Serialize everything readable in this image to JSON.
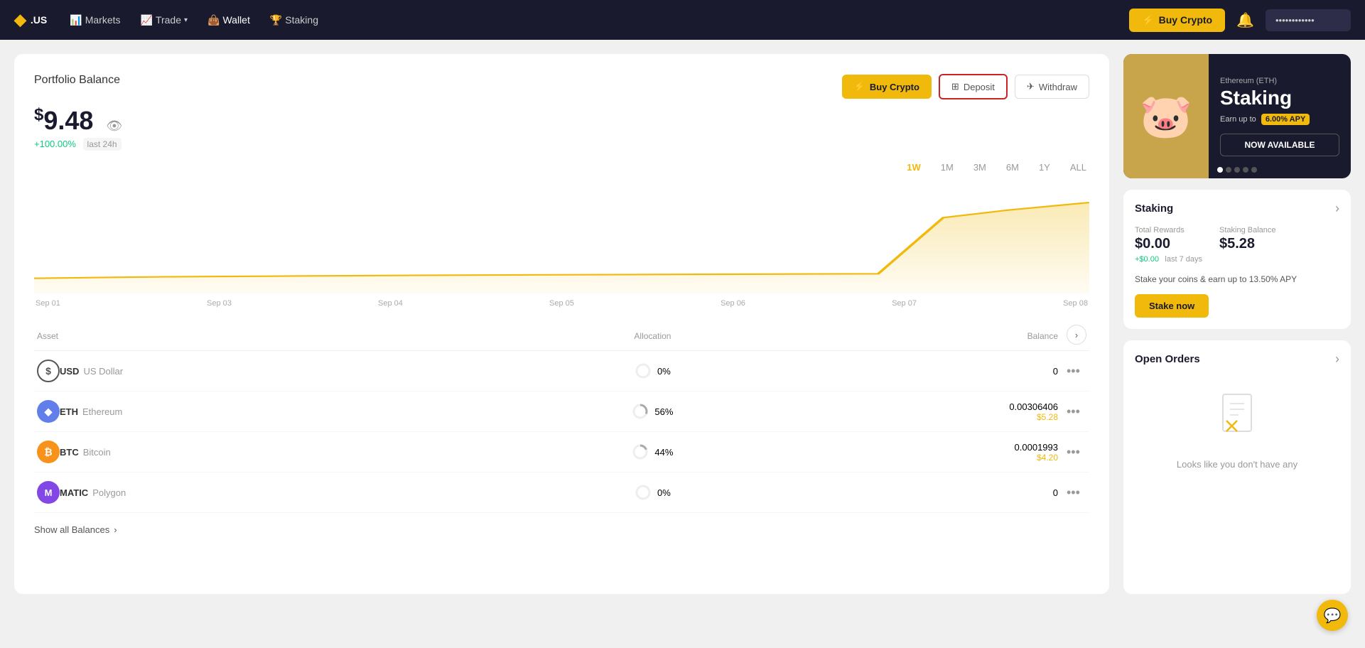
{
  "navbar": {
    "logo": "◆.US",
    "logo_symbol": "◆",
    "logo_text": ".US",
    "links": [
      {
        "label": "Markets",
        "icon": "📊",
        "active": false
      },
      {
        "label": "Trade",
        "icon": "📈",
        "active": false,
        "has_dropdown": true
      },
      {
        "label": "Wallet",
        "active": true
      },
      {
        "label": "Staking",
        "icon": "🏆",
        "active": false
      }
    ],
    "buy_crypto_label": "Buy Crypto",
    "user_button_label": "••••••••••••"
  },
  "portfolio": {
    "title": "Portfolio Balance",
    "balance": "9.48",
    "balance_symbol": "$",
    "change_percent": "+100.00%",
    "change_period": "last 24h",
    "actions": {
      "buy_crypto": "Buy Crypto",
      "deposit": "Deposit",
      "withdraw": "Withdraw"
    }
  },
  "chart": {
    "time_filters": [
      "1W",
      "1M",
      "3M",
      "6M",
      "1Y",
      "ALL"
    ],
    "active_filter": "1W",
    "x_labels": [
      "Sep 01",
      "Sep 03",
      "Sep 04",
      "Sep 05",
      "Sep 06",
      "Sep 07",
      "Sep 08"
    ]
  },
  "assets": {
    "columns": [
      "Asset",
      "Allocation",
      "Balance",
      ""
    ],
    "expand_label": "›",
    "rows": [
      {
        "ticker": "USD",
        "name": "US Dollar",
        "icon_text": "$",
        "icon_type": "usd",
        "allocation_pct": "0%",
        "balance_amount": "0",
        "balance_usd": null,
        "allocation_val": 0
      },
      {
        "ticker": "ETH",
        "name": "Ethereum",
        "icon_text": "◆",
        "icon_type": "eth",
        "allocation_pct": "56%",
        "balance_amount": "0.00306406",
        "balance_usd": "$5.28",
        "allocation_val": 56
      },
      {
        "ticker": "BTC",
        "name": "Bitcoin",
        "icon_text": "₿",
        "icon_type": "btc",
        "allocation_pct": "44%",
        "balance_amount": "0.0001993",
        "balance_usd": "$4.20",
        "allocation_val": 44
      },
      {
        "ticker": "MATIC",
        "name": "Polygon",
        "icon_text": "M",
        "icon_type": "matic",
        "allocation_pct": "0%",
        "balance_amount": "0",
        "balance_usd": null,
        "allocation_val": 0
      }
    ],
    "show_all_label": "Show all Balances"
  },
  "right_panel": {
    "banner": {
      "subtitle": "Ethereum (ETH)",
      "title": "Staking",
      "earn_up_to_label": "Earn up to",
      "apy": "6.00% APY",
      "cta": "NOW AVAILABLE",
      "dots": 5
    },
    "staking": {
      "title": "Staking",
      "total_rewards_label": "Total Rewards",
      "total_rewards_value": "$0.00",
      "total_rewards_change": "+$0.00",
      "total_rewards_period": "last 7 days",
      "staking_balance_label": "Staking Balance",
      "staking_balance_value": "$5.28",
      "description": "Stake your coins & earn up to 13.50% APY",
      "stake_now_label": "Stake now"
    },
    "open_orders": {
      "title": "Open Orders",
      "empty_text": "Looks like you don't have any"
    }
  },
  "float_chat_label": "💬"
}
